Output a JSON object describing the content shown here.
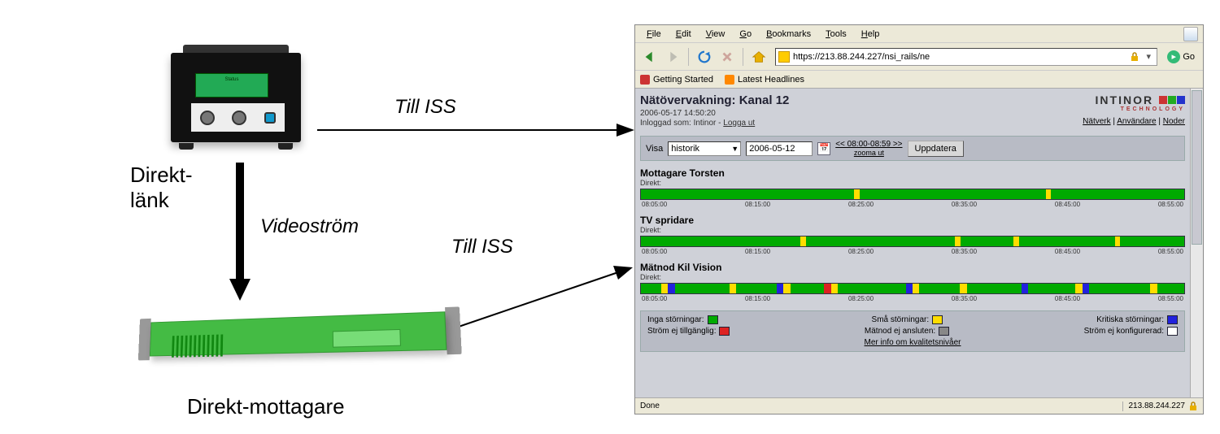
{
  "diagram": {
    "label_direktlank": "Direkt-\nlänk",
    "label_direktmottagare": "Direkt-mottagare",
    "label_videostrom": "Videoström",
    "label_till_iss": "Till ISS",
    "lcd_line1": "Status"
  },
  "browser": {
    "menus": [
      "File",
      "Edit",
      "View",
      "Go",
      "Bookmarks",
      "Tools",
      "Help"
    ],
    "url": "https://213.88.244.227/nsi_rails/ne",
    "go_label": "Go",
    "bookmarks": {
      "getting_started": "Getting Started",
      "latest_headlines": "Latest Headlines"
    },
    "status_left": "Done",
    "status_right": "213.88.244.227"
  },
  "page": {
    "title": "Nätövervakning: Kanal 12",
    "timestamp": "2006-05-17 14:50:20",
    "logged_in_prefix": "Inloggad som: Intinor - ",
    "logout": "Logga ut",
    "brand": "INTINOR",
    "brand_sub": "TECHNOLOGY",
    "nav": {
      "natverk": "Nätverk",
      "anvandare": "Användare",
      "noder": "Noder"
    },
    "controls": {
      "visa": "Visa",
      "select_value": "historik",
      "date_value": "2006-05-12",
      "time_range": "<< 08:00-08:59 >>",
      "zooma_ut": "zooma ut",
      "uppdatera": "Uppdatera"
    },
    "sections": [
      {
        "title": "Mottagare Torsten",
        "sub": "Direkt:"
      },
      {
        "title": "TV spridare",
        "sub": "Direkt:"
      },
      {
        "title": "Mätnod Kil Vision",
        "sub": "Direkt:"
      }
    ],
    "ticks": [
      "08:05:00",
      "08:15:00",
      "08:25:00",
      "08:35:00",
      "08:45:00",
      "08:55:00"
    ],
    "legend": {
      "inga": "Inga störningar:",
      "sma": "Små störningar:",
      "kritiska": "Kritiska störningar:",
      "ejtill": "Ström ej tillgänglig:",
      "matnod": "Mätnod ej ansluten:",
      "ejkonf": "Ström ej konfigurerad:",
      "merinfo": "Mer info om kvalitetsnivåer"
    }
  }
}
